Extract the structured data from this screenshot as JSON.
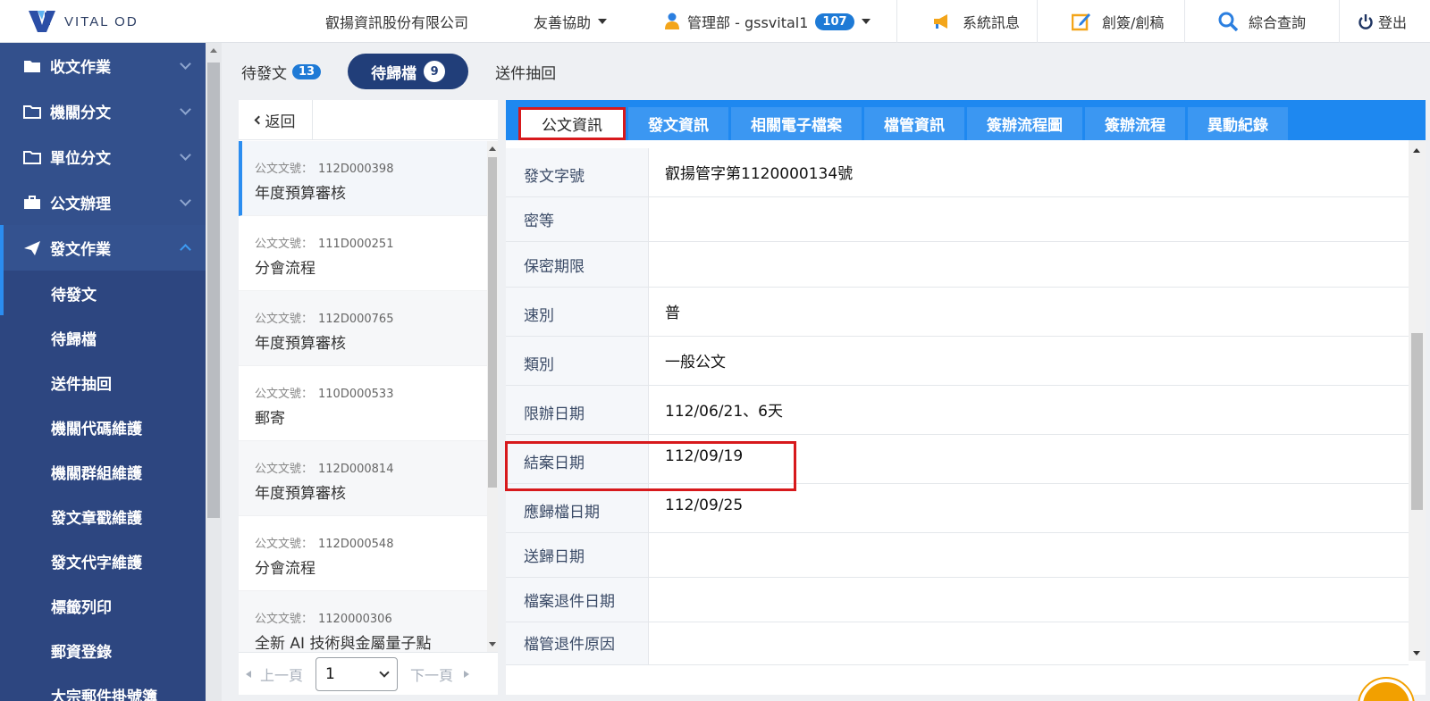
{
  "header": {
    "logo_text": "VITAL OD",
    "company": "叡揚資訊股份有限公司",
    "assist": "友善協助",
    "user": "管理部 - gssvital1",
    "user_badge": "107",
    "system_message": "系統訊息",
    "draft": "創簽/創稿",
    "query": "綜合查詢",
    "logout": "登出"
  },
  "sidebar": {
    "groups": [
      {
        "label": "收文作業"
      },
      {
        "label": "機關分文"
      },
      {
        "label": "單位分文"
      },
      {
        "label": "公文辦理"
      },
      {
        "label": "發文作業"
      }
    ],
    "sub_items": [
      {
        "label": "待發文"
      },
      {
        "label": "待歸檔"
      },
      {
        "label": "送件抽回"
      },
      {
        "label": "機關代碼維護"
      },
      {
        "label": "機關群組維護"
      },
      {
        "label": "發文章戳維護"
      },
      {
        "label": "發文代字維護"
      },
      {
        "label": "標籤列印"
      },
      {
        "label": "郵資登錄"
      },
      {
        "label": "大宗郵件掛號簿"
      }
    ]
  },
  "tabs": [
    {
      "label": "待發文",
      "count": "13"
    },
    {
      "label": "待歸檔",
      "count": "9"
    },
    {
      "label": "送件抽回"
    }
  ],
  "list": {
    "back_label": "返回",
    "doc_no_label": "公文文號：",
    "items": [
      {
        "no": "112D000398",
        "title": "年度預算審核"
      },
      {
        "no": "111D000251",
        "title": "分會流程"
      },
      {
        "no": "112D000765",
        "title": "年度預算審核"
      },
      {
        "no": "110D000533",
        "title": "郵寄"
      },
      {
        "no": "112D000814",
        "title": "年度預算審核"
      },
      {
        "no": "112D000548",
        "title": "分會流程"
      },
      {
        "no": "1120000306",
        "title": "全新 AI 技術與金屬量子點"
      }
    ],
    "pager": {
      "prev": "上一頁",
      "page": "1",
      "next": "下一頁"
    }
  },
  "detail": {
    "tabs": [
      "公文資訊",
      "發文資訊",
      "相關電子檔案",
      "檔管資訊",
      "簽辦流程圖",
      "簽辦流程",
      "異動紀錄"
    ],
    "rows": [
      {
        "label": "發文字號",
        "value": "叡揚管字第1120000134號"
      },
      {
        "label": "密等",
        "value": ""
      },
      {
        "label": "保密期限",
        "value": ""
      },
      {
        "label": "速別",
        "value": "普"
      },
      {
        "label": "類別",
        "value": "一般公文"
      },
      {
        "label": "限辦日期",
        "value": "112/06/21、6天"
      },
      {
        "label": "結案日期",
        "value": "112/09/19"
      },
      {
        "label": "應歸檔日期",
        "value": "112/09/25"
      },
      {
        "label": "送歸日期",
        "value": ""
      },
      {
        "label": "檔案退件日期",
        "value": ""
      },
      {
        "label": "檔管退件原因",
        "value": ""
      }
    ]
  },
  "colors": {
    "sidebar": "#2f4a82",
    "accent": "#1e88f0",
    "active_pill": "#213e79",
    "highlight": "#d7191c"
  }
}
